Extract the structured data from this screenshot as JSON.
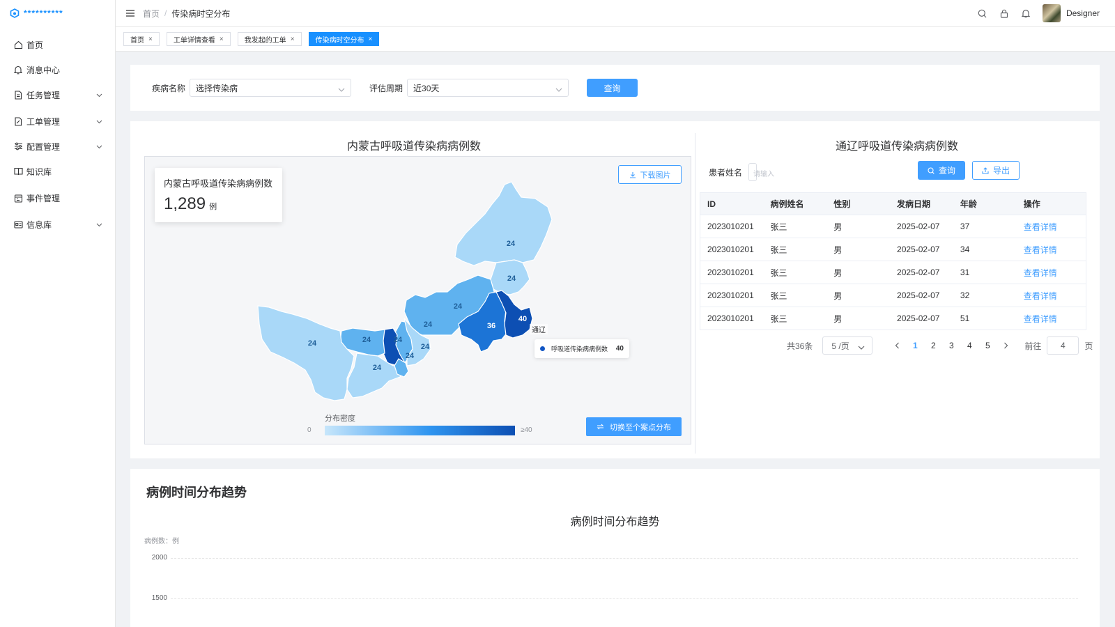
{
  "app": {
    "logo_text": "**********",
    "user_name": "Designer"
  },
  "sidebar": {
    "items": [
      {
        "label": "首页",
        "icon": "home-icon"
      },
      {
        "label": "消息中心",
        "icon": "bell-icon"
      },
      {
        "label": "任务管理",
        "icon": "document-icon",
        "expandable": true
      },
      {
        "label": "工单管理",
        "icon": "edit-document-icon",
        "expandable": true
      },
      {
        "label": "配置管理",
        "icon": "sliders-icon",
        "expandable": true
      },
      {
        "label": "知识库",
        "icon": "book-icon"
      },
      {
        "label": "事件管理",
        "icon": "calendar-icon"
      },
      {
        "label": "信息库",
        "icon": "id-card-icon",
        "expandable": true
      }
    ]
  },
  "breadcrumb": {
    "home": "首页",
    "current": "传染病时空分布"
  },
  "tabs": [
    {
      "label": "首页",
      "active": false
    },
    {
      "label": "工单详情查看",
      "active": false
    },
    {
      "label": "我发起的工单",
      "active": false
    },
    {
      "label": "传染病时空分布",
      "active": true
    }
  ],
  "filter": {
    "disease_label": "疾病名称",
    "disease_value": "选择传染病",
    "period_label": "评估周期",
    "period_value": "近30天",
    "query_label": "查询"
  },
  "map_section": {
    "title": "内蒙古呼吸道传染病病例数",
    "stat_title": "内蒙古呼吸道传染病病例数",
    "stat_value": "1,289",
    "stat_unit": "例",
    "download_label": "下载图片",
    "switch_label": "切换至个案点分布",
    "legend_title": "分布密度",
    "legend_min": "0",
    "legend_max": "≥40",
    "tooltip": {
      "region": "通辽",
      "series": "呼吸道传染病病例数",
      "value": "40"
    },
    "region_values": [
      "24",
      "24",
      "24",
      "24",
      "36",
      "40",
      "24",
      "24",
      "24",
      "24",
      "24",
      "24"
    ],
    "colors": {
      "light": "#a9d8f8",
      "mid": "#5fb2ef",
      "dark": "#1c74d6",
      "darkest": "#0d4fb3"
    }
  },
  "table_section": {
    "title": "通辽呼吸道传染病病例数",
    "patient_label": "患者姓名",
    "patient_placeholder": "请输入",
    "search_label": "查询",
    "export_label": "导出",
    "columns": [
      "ID",
      "病例姓名",
      "性别",
      "发病日期",
      "年龄",
      "操作"
    ],
    "rows": [
      [
        "2023010201",
        "张三",
        "男",
        "2025-02-07",
        "37",
        "查看详情"
      ],
      [
        "2023010201",
        "张三",
        "男",
        "2025-02-07",
        "34",
        "查看详情"
      ],
      [
        "2023010201",
        "张三",
        "男",
        "2025-02-07",
        "31",
        "查看详情"
      ],
      [
        "2023010201",
        "张三",
        "男",
        "2025-02-07",
        "32",
        "查看详情"
      ],
      [
        "2023010201",
        "张三",
        "男",
        "2025-02-07",
        "51",
        "查看详情"
      ]
    ],
    "pagination": {
      "total": "共36条",
      "page_size": "5 /页",
      "pages": [
        "1",
        "2",
        "3",
        "4",
        "5"
      ],
      "current": "1",
      "goto_label": "前往",
      "goto_value": "4",
      "page_suffix": "页"
    }
  },
  "trend_section": {
    "heading": "病例时间分布趋势",
    "chart_title": "病例时间分布趋势",
    "y_unit_label": "病例数：例",
    "y_ticks": [
      "2000",
      "1500"
    ]
  }
}
